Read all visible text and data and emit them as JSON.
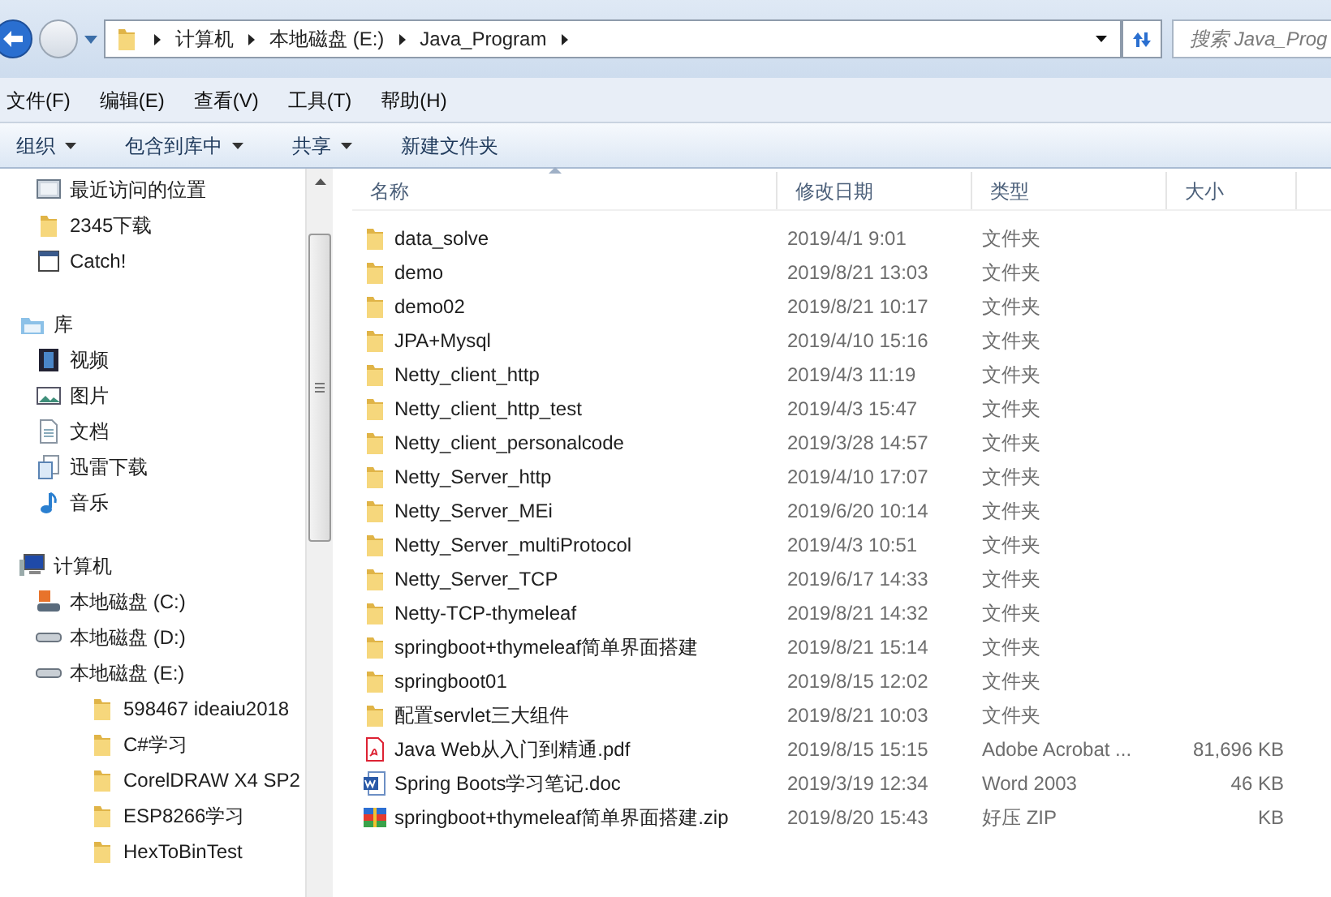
{
  "nav": {
    "breadcrumb": [
      "计算机",
      "本地磁盘 (E:)",
      "Java_Program"
    ],
    "search": {
      "placeholder": "搜索 Java_Prog"
    }
  },
  "menu": [
    "文件(F)",
    "编辑(E)",
    "查看(V)",
    "工具(T)",
    "帮助(H)"
  ],
  "toolbar": [
    {
      "label": "组织",
      "dropdown": true
    },
    {
      "label": "包含到库中",
      "dropdown": true
    },
    {
      "label": "共享",
      "dropdown": true
    },
    {
      "label": "新建文件夹",
      "dropdown": false
    }
  ],
  "sidebar": {
    "sections": [
      {
        "items": [
          {
            "label": "最近访问的位置",
            "kind": "recent"
          },
          {
            "label": "2345下载",
            "kind": "folder"
          },
          {
            "label": "Catch!",
            "kind": "app"
          }
        ]
      },
      {
        "label": "库",
        "kind": "library",
        "items": [
          {
            "label": "视频",
            "kind": "video"
          },
          {
            "label": "图片",
            "kind": "picture"
          },
          {
            "label": "文档",
            "kind": "document"
          },
          {
            "label": "迅雷下载",
            "kind": "download"
          },
          {
            "label": "音乐",
            "kind": "music"
          }
        ]
      },
      {
        "label": "计算机",
        "kind": "computer",
        "items": [
          {
            "label": "本地磁盘 (C:)",
            "kind": "system-drive"
          },
          {
            "label": "本地磁盘 (D:)",
            "kind": "drive"
          },
          {
            "label": "本地磁盘 (E:)",
            "kind": "drive",
            "children": [
              {
                "label": "598467 ideaiu2018",
                "kind": "folder"
              },
              {
                "label": "C#学习",
                "kind": "folder"
              },
              {
                "label": "CorelDRAW X4 SP2",
                "kind": "folder"
              },
              {
                "label": "ESP8266学习",
                "kind": "folder"
              },
              {
                "label": "HexToBinTest",
                "kind": "folder"
              }
            ]
          }
        ]
      }
    ]
  },
  "columns": [
    {
      "label": "名称",
      "sorted": true
    },
    {
      "label": "修改日期",
      "sorted": false
    },
    {
      "label": "类型",
      "sorted": false
    },
    {
      "label": "大小",
      "sorted": false
    }
  ],
  "files": [
    {
      "name": "data_solve",
      "date": "2019/4/1 9:01",
      "type": "文件夹",
      "kind": "folder"
    },
    {
      "name": "demo",
      "date": "2019/8/21 13:03",
      "type": "文件夹",
      "kind": "folder"
    },
    {
      "name": "demo02",
      "date": "2019/8/21 10:17",
      "type": "文件夹",
      "kind": "folder"
    },
    {
      "name": "JPA+Mysql",
      "date": "2019/4/10 15:16",
      "type": "文件夹",
      "kind": "folder"
    },
    {
      "name": "Netty_client_http",
      "date": "2019/4/3 11:19",
      "type": "文件夹",
      "kind": "folder"
    },
    {
      "name": "Netty_client_http_test",
      "date": "2019/4/3 15:47",
      "type": "文件夹",
      "kind": "folder"
    },
    {
      "name": "Netty_client_personalcode",
      "date": "2019/3/28 14:57",
      "type": "文件夹",
      "kind": "folder"
    },
    {
      "name": "Netty_Server_http",
      "date": "2019/4/10 17:07",
      "type": "文件夹",
      "kind": "folder"
    },
    {
      "name": "Netty_Server_MEi",
      "date": "2019/6/20 10:14",
      "type": "文件夹",
      "kind": "folder"
    },
    {
      "name": "Netty_Server_multiProtocol",
      "date": "2019/4/3 10:51",
      "type": "文件夹",
      "kind": "folder"
    },
    {
      "name": "Netty_Server_TCP",
      "date": "2019/6/17 14:33",
      "type": "文件夹",
      "kind": "folder"
    },
    {
      "name": "Netty-TCP-thymeleaf",
      "date": "2019/8/21 14:32",
      "type": "文件夹",
      "kind": "folder"
    },
    {
      "name": "springboot+thymeleaf简单界面搭建",
      "date": "2019/8/21 15:14",
      "type": "文件夹",
      "kind": "folder"
    },
    {
      "name": "springboot01",
      "date": "2019/8/15 12:02",
      "type": "文件夹",
      "kind": "folder"
    },
    {
      "name": "配置servlet三大组件",
      "date": "2019/8/21 10:03",
      "type": "文件夹",
      "kind": "folder"
    },
    {
      "name": "Java Web从入门到精通.pdf",
      "date": "2019/8/15 15:15",
      "type": "Adobe Acrobat ...",
      "size": "81,696 KB",
      "kind": "pdf"
    },
    {
      "name": "Spring Boots学习笔记.doc",
      "date": "2019/3/19 12:34",
      "type": "Word 2003",
      "size": "46 KB",
      "kind": "doc"
    },
    {
      "name": "springboot+thymeleaf简单界面搭建.zip",
      "date": "2019/8/20 15:43",
      "type": "好压 ZIP",
      "size": "KB",
      "kind": "zip"
    }
  ]
}
